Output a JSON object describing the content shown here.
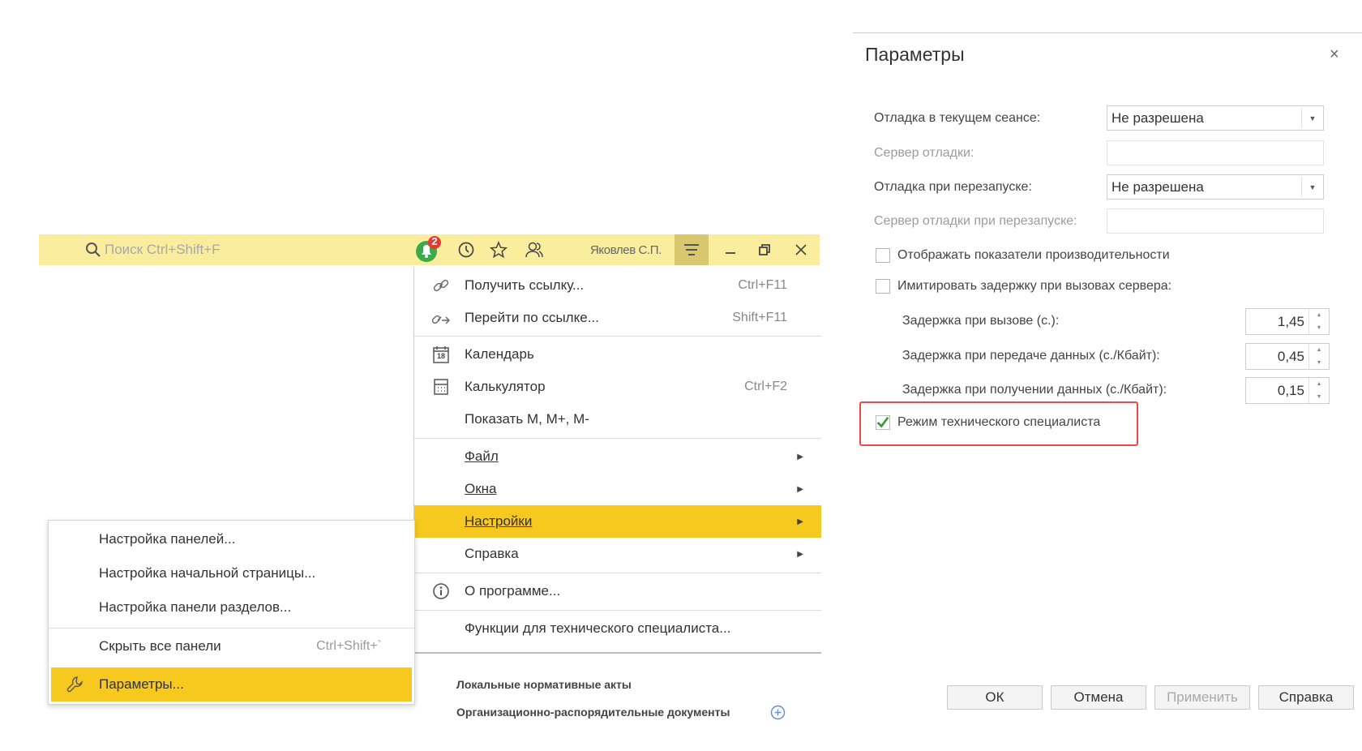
{
  "topbar": {
    "search_placeholder": "Поиск Ctrl+Shift+F",
    "notification_count": "2",
    "user_name": "Яковлев С.П."
  },
  "main_menu": {
    "items": [
      {
        "label": "Получить ссылку...",
        "shortcut": "Ctrl+F11"
      },
      {
        "label": "Перейти по ссылке...",
        "shortcut": "Shift+F11"
      },
      {
        "label": "Календарь",
        "calendar_day": "18"
      },
      {
        "label": "Калькулятор",
        "shortcut": "Ctrl+F2"
      },
      {
        "label": "Показать M, M+, M-"
      },
      {
        "label": "Файл"
      },
      {
        "label": "Окна"
      },
      {
        "label": "Настройки"
      },
      {
        "label": "Справка"
      },
      {
        "label": "О программе..."
      },
      {
        "label": "Функции для технического специалиста..."
      }
    ]
  },
  "sub_menu": {
    "items": [
      {
        "label": "Настройка панелей..."
      },
      {
        "label": "Настройка начальной страницы..."
      },
      {
        "label": "Настройка панели разделов..."
      },
      {
        "label": "Скрыть все панели",
        "shortcut": "Ctrl+Shift+`"
      },
      {
        "label": "Параметры..."
      }
    ]
  },
  "background": {
    "line1": "Локальные нормативные акты",
    "line2": "Организационно-распорядительные документы"
  },
  "dialog": {
    "title": "Параметры",
    "close": "×",
    "fields": {
      "debug_session_label": "Отладка в текущем сеансе:",
      "debug_session_value": "Не разрешена",
      "debug_server_label": "Сервер отладки:",
      "debug_restart_label": "Отладка при перезапуске:",
      "debug_restart_value": "Не разрешена",
      "debug_restart_server_label": "Сервер отладки при перезапуске:"
    },
    "checkboxes": {
      "perf": {
        "label": "Отображать показатели производительности",
        "checked": false
      },
      "delay": {
        "label": "Имитировать задержку при вызовах сервера:",
        "checked": false
      },
      "tech": {
        "label": "Режим технического специалиста",
        "checked": true
      }
    },
    "delays": [
      {
        "label": "Задержка при вызове (с.):",
        "value": "1,45"
      },
      {
        "label": "Задержка при передаче данных (с./Кбайт):",
        "value": "0,45"
      },
      {
        "label": "Задержка при получении данных (с./Кбайт):",
        "value": "0,15"
      }
    ],
    "buttons": {
      "ok": "ОК",
      "cancel": "Отмена",
      "apply": "Применить",
      "help": "Справка"
    }
  },
  "colors": {
    "accent_yellow": "#f7c81e",
    "topbar_yellow": "#fbed9e",
    "highlight_red": "#e8494d",
    "check_green": "#3a9a3a",
    "notify_green": "#3aaa4a",
    "notify_red": "#e53935"
  }
}
